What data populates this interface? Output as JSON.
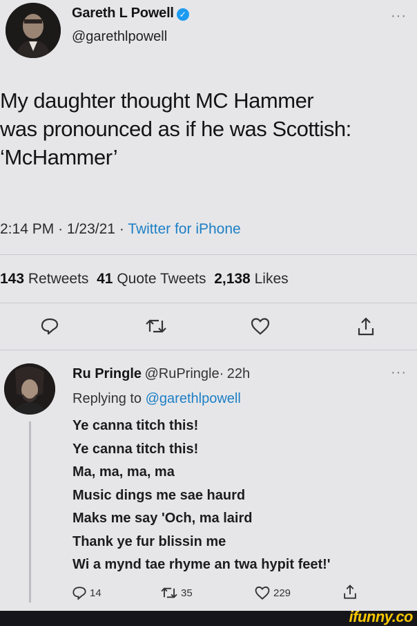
{
  "tweet": {
    "author_name": "Gareth L Powell",
    "author_handle": "@garethlpowell",
    "verified": true,
    "text_lines": [
      "My daughter thought MC Hammer",
      "was pronounced as if he was Scottish:",
      "‘McHammer’"
    ],
    "time": "2:14 PM",
    "date": "1/23/21",
    "source": "Twitter for iPhone",
    "separator": "·",
    "stats": {
      "retweets_count": "143",
      "retweets_label": "Retweets",
      "quotes_count": "41",
      "quotes_label": "Quote Tweets",
      "likes_count": "2,138",
      "likes_label": "Likes"
    },
    "actions": [
      "reply-icon",
      "retweet-icon",
      "like-icon",
      "share-icon"
    ]
  },
  "reply": {
    "author_name": "Ru Pringle",
    "author_handle": "@RuPringle",
    "age": "22h",
    "separator": "·",
    "replying_prefix": "Replying to",
    "replying_handle": "@garethlpowell",
    "lines": [
      "Ye canna titch this!",
      "Ye canna titch this!",
      "Ma, ma, ma, ma",
      "Music dings me sae haurd",
      "Maks me say 'Och, ma laird",
      "Thank ye fur blissin me",
      "Wi a mynd tae rhyme an twa hypit feet!'"
    ],
    "reply_count": "14",
    "retweet_count": "35",
    "like_count": "229"
  },
  "more_label": "···",
  "watermark": "ifunny.co",
  "colors": {
    "background": "#e6e6e9",
    "link": "#1d7fc4",
    "verified": "#1d9bf0",
    "brand": "#f7c600"
  }
}
